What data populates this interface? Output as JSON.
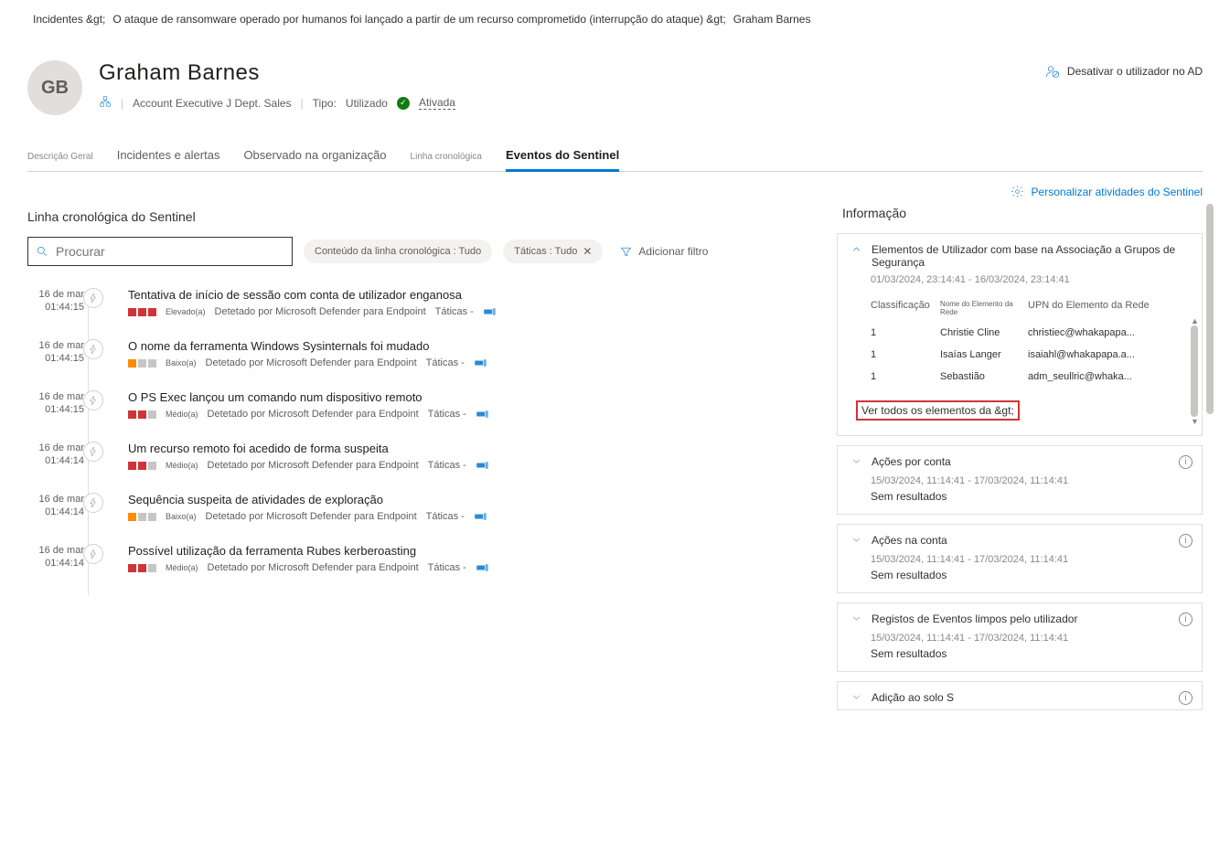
{
  "breadcrumb": {
    "root": "Incidentes  &gt;",
    "incident": "O ataque de ransomware operado por humanos foi lançado a partir de um recurso comprometido (interrupção do ataque)  &gt;",
    "entity": "Graham Barnes"
  },
  "header": {
    "initials": "GB",
    "name": "Graham   Barnes",
    "role": "Account Executive J Dept. Sales",
    "type_label": "Tipo:",
    "type_value": "Utilizado",
    "status": "Ativada",
    "action_disable": "Desativar o utilizador no AD"
  },
  "tabs": {
    "overview_small": "Descrição Geral",
    "incidents": "Incidentes e alertas",
    "observed": "Observado na organização",
    "timeline_small": "Linha cronológica",
    "sentinel": "Eventos do Sentinel"
  },
  "toolbar": {
    "customize": "Personalizar atividades do Sentinel"
  },
  "timeline": {
    "title": "Linha cronológica do Sentinel",
    "search_placeholder": "Procurar",
    "pill_content": "Conteúdo da linha cronológica : Tudo",
    "pill_tactics": "Táticas : Tudo",
    "add_filter": "Adicionar filtro",
    "detected_by": "Detetado por Microsoft Defender para Endpoint",
    "tactics_label": "Táticas -",
    "items": [
      {
        "date": "16 de mar",
        "time": "01:44:15",
        "title": "Tentativa de início de sessão com conta de utilizador enganosa",
        "sev": [
          "r",
          "r",
          "r"
        ],
        "sev_label": "Elevado(a)"
      },
      {
        "date": "16 de mar",
        "time": "01:44:15",
        "title": "O nome da ferramenta Windows Sysinternals foi mudado",
        "sev": [
          "o",
          "g",
          "g"
        ],
        "sev_label": "Baixo(a)"
      },
      {
        "date": "16 de mar",
        "time": "01:44:15",
        "title": "O PS Exec lançou um comando num dispositivo remoto",
        "sev": [
          "r",
          "r",
          "g"
        ],
        "sev_label": "Médio(a)"
      },
      {
        "date": "16 de mar",
        "time": "01:44:14",
        "title": "Um recurso remoto foi acedido de forma suspeita",
        "sev": [
          "r",
          "r",
          "g"
        ],
        "sev_label": "Médio(a)"
      },
      {
        "date": "16 de mar",
        "time": "01:44:14",
        "title": "Sequência suspeita de atividades de exploração",
        "sev": [
          "o",
          "g",
          "g"
        ],
        "sev_label": "Baixo(a)"
      },
      {
        "date": "16 de mar",
        "time": "01:44:14",
        "title": "Possível utilização da ferramenta Rubes kerberoasting",
        "sev": [
          "r",
          "r",
          "g"
        ],
        "sev_label": "Médio(a)"
      }
    ]
  },
  "info": {
    "title": "Informação",
    "panel1": {
      "title": "Elementos de Utilizador com base na Associação a Grupos de Segurança",
      "range": "01/03/2024, 23:14:41 - 16/03/2024, 23:14:41",
      "cols": {
        "c1": "Classificação",
        "c2": "Nome do Elemento da Rede",
        "c3": "UPN do Elemento da Rede"
      },
      "rows": [
        {
          "c1": "1",
          "c2": "Christie Cline",
          "c3": "christiec@whakapapa..."
        },
        {
          "c1": "1",
          "c2": "Isaías Langer",
          "c3": "isaiahl@whakapapa.a..."
        },
        {
          "c1": "1",
          "c2": "Sebastião",
          "c3": "adm_seullric@whaka..."
        }
      ],
      "view_all": "Ver todos os elementos da  &gt;"
    },
    "panel2": {
      "title": "Ações por conta",
      "range": "15/03/2024, 11:14:41 - 17/03/2024, 11:14:41",
      "result": "Sem resultados"
    },
    "panel3": {
      "title": "Ações na conta",
      "range": "15/03/2024, 11:14:41 - 17/03/2024, 11:14:41",
      "result": "Sem resultados"
    },
    "panel4": {
      "title": "Registos de Eventos limpos pelo utilizador",
      "range": "15/03/2024, 11:14:41 - 17/03/2024, 11:14:41",
      "result": "Sem resultados"
    },
    "panel5": {
      "title": "Adição ao solo          S"
    }
  }
}
